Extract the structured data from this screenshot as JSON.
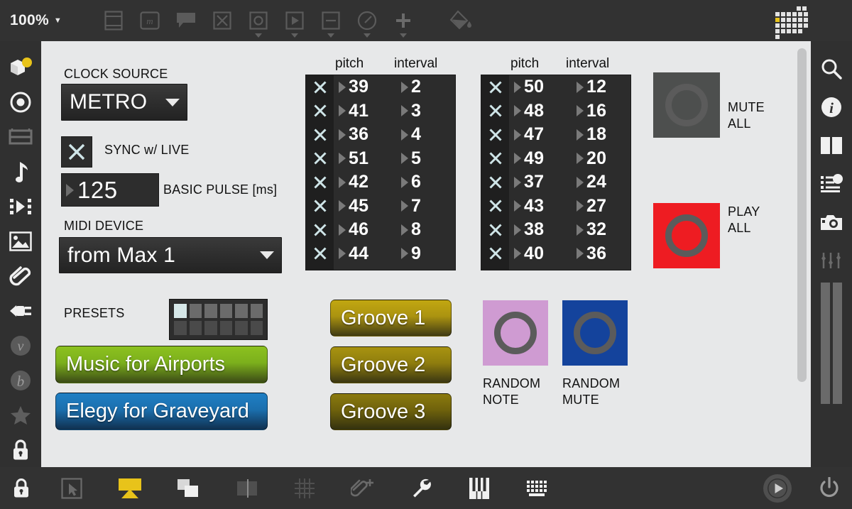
{
  "toolbar": {
    "zoom_level": "100%",
    "zoom_caret": "▼",
    "items": [
      {
        "name": "page-layout-icon",
        "label": "Page Layout"
      },
      {
        "name": "music-notation-icon",
        "label": "Notation"
      },
      {
        "name": "comment-icon",
        "label": "Comment"
      },
      {
        "name": "close-box-icon",
        "label": "Close Box"
      },
      {
        "name": "circle-box-icon",
        "label": "Toggle"
      },
      {
        "name": "play-box-icon",
        "label": "Play Box"
      },
      {
        "name": "minus-box-icon",
        "label": "Minus Box"
      },
      {
        "name": "gauge-icon",
        "label": "Gauge"
      },
      {
        "name": "plus-icon",
        "label": "Add"
      },
      {
        "name": "paint-bucket-icon",
        "label": "Fill Color"
      }
    ],
    "matrix_icon_label": "Matrix"
  },
  "left_sidebar": {
    "items": [
      {
        "name": "sidebar-object-icon",
        "label": "Objects"
      },
      {
        "name": "sidebar-target-icon",
        "label": "Target"
      },
      {
        "name": "sidebar-keyboard-panel-icon",
        "label": "Panel"
      },
      {
        "name": "sidebar-note-icon",
        "label": "Audio"
      },
      {
        "name": "sidebar-clip-icon",
        "label": "Clip"
      },
      {
        "name": "sidebar-image-icon",
        "label": "Image"
      },
      {
        "name": "sidebar-paperclip-icon",
        "label": "Attachments"
      },
      {
        "name": "sidebar-plug-icon",
        "label": "Plugin"
      },
      {
        "name": "sidebar-v-icon",
        "label": "Vizzie"
      },
      {
        "name": "sidebar-b-icon",
        "label": "BEAP"
      },
      {
        "name": "sidebar-star-icon",
        "label": "Favorites"
      },
      {
        "name": "sidebar-lock-icon",
        "label": "Lock"
      }
    ]
  },
  "right_sidebar": {
    "items": [
      {
        "name": "search-icon",
        "label": "Search"
      },
      {
        "name": "info-icon",
        "label": "Inspector"
      },
      {
        "name": "columns-icon",
        "label": "Layout"
      },
      {
        "name": "list-icon",
        "label": "Parameters"
      },
      {
        "name": "camera-icon",
        "label": "Snapshot"
      },
      {
        "name": "sliders-icon",
        "label": "Mixer"
      },
      {
        "name": "level-meters-icon",
        "label": "Levels"
      },
      {
        "name": "power-icon",
        "label": "Audio On/Off"
      }
    ]
  },
  "bottom_bar": {
    "items": [
      {
        "name": "lock-icon",
        "label": "Edit Lock"
      },
      {
        "name": "select-cursor-icon",
        "label": "Select"
      },
      {
        "name": "presentation-icon",
        "label": "Presentation Mode",
        "active": true
      },
      {
        "name": "copy-layers-icon",
        "label": "Arrange"
      },
      {
        "name": "snap-icon",
        "label": "Snap"
      },
      {
        "name": "grid-icon",
        "label": "Grid"
      },
      {
        "name": "add-attachment-icon",
        "label": "Add Clipping"
      },
      {
        "name": "wrench-icon",
        "label": "Tools"
      },
      {
        "name": "piano-icon",
        "label": "Keyboard"
      },
      {
        "name": "computer-keyboard-icon",
        "label": "Computer Keyboard"
      },
      {
        "name": "play-transport-icon",
        "label": "Play"
      },
      {
        "name": "power-toggle-icon",
        "label": "Audio Power"
      }
    ]
  },
  "patch": {
    "clock_source": {
      "label": "CLOCK SOURCE",
      "value": "METRO",
      "caret": "▼"
    },
    "sync": {
      "label": "SYNC w/ LIVE",
      "checked": true,
      "glyph": "X"
    },
    "basic_pulse": {
      "label": "BASIC PULSE [ms]",
      "value": "125"
    },
    "midi_device": {
      "label": "MIDI DEVICE",
      "value": "from Max 1",
      "caret": "▼"
    },
    "presets": {
      "label": "PRESETS",
      "cells": [
        "on",
        "row1",
        "row1",
        "row1",
        "row1",
        "row1",
        "row2",
        "row2",
        "row2",
        "row2",
        "row2",
        "row2"
      ]
    },
    "preset_buttons": [
      {
        "label": "Music for Airports",
        "color": "#8cc11f"
      },
      {
        "label": "Elegy for Graveyard",
        "color": "#1f7fc4"
      }
    ],
    "groove_buttons": [
      {
        "label": "Groove 1",
        "color": "#c2a711"
      },
      {
        "label": "Groove 2",
        "color": "#a89310"
      },
      {
        "label": "Groove 3",
        "color": "#8b7a0e"
      }
    ],
    "voice_lists": [
      {
        "headers": {
          "pitch": "pitch",
          "interval": "interval"
        },
        "rows": [
          {
            "mute": "X",
            "pitch": "39",
            "interval": "2"
          },
          {
            "mute": "X",
            "pitch": "41",
            "interval": "3"
          },
          {
            "mute": "X",
            "pitch": "36",
            "interval": "4"
          },
          {
            "mute": "X",
            "pitch": "51",
            "interval": "5"
          },
          {
            "mute": "X",
            "pitch": "42",
            "interval": "6"
          },
          {
            "mute": "X",
            "pitch": "45",
            "interval": "7"
          },
          {
            "mute": "X",
            "pitch": "46",
            "interval": "8"
          },
          {
            "mute": "X",
            "pitch": "44",
            "interval": "9"
          }
        ]
      },
      {
        "headers": {
          "pitch": "pitch",
          "interval": "interval"
        },
        "rows": [
          {
            "mute": "X",
            "pitch": "50",
            "interval": "12"
          },
          {
            "mute": "X",
            "pitch": "48",
            "interval": "16"
          },
          {
            "mute": "X",
            "pitch": "47",
            "interval": "18"
          },
          {
            "mute": "X",
            "pitch": "49",
            "interval": "20"
          },
          {
            "mute": "X",
            "pitch": "37",
            "interval": "24"
          },
          {
            "mute": "X",
            "pitch": "43",
            "interval": "27"
          },
          {
            "mute": "X",
            "pitch": "38",
            "interval": "32"
          },
          {
            "mute": "X",
            "pitch": "40",
            "interval": "36"
          }
        ]
      }
    ],
    "transport": {
      "mute_all": {
        "label": "MUTE\nALL",
        "color": "#4d4f4e",
        "active": false
      },
      "play_all": {
        "label": "PLAY\nALL",
        "color": "#ee1c22",
        "active": true
      }
    },
    "random": {
      "note": {
        "label": "RANDOM\nNOTE",
        "color": "#cf9bd2"
      },
      "mute": {
        "label": "RANDOM\nMUTE",
        "color": "#14439c"
      }
    }
  },
  "colors": {
    "canvas_bg": "#e7e8e9",
    "chrome": "#323232",
    "accent_yellow": "#e8c31a",
    "red": "#ee1c22",
    "blue": "#14439c",
    "pink": "#cf9bd2"
  }
}
